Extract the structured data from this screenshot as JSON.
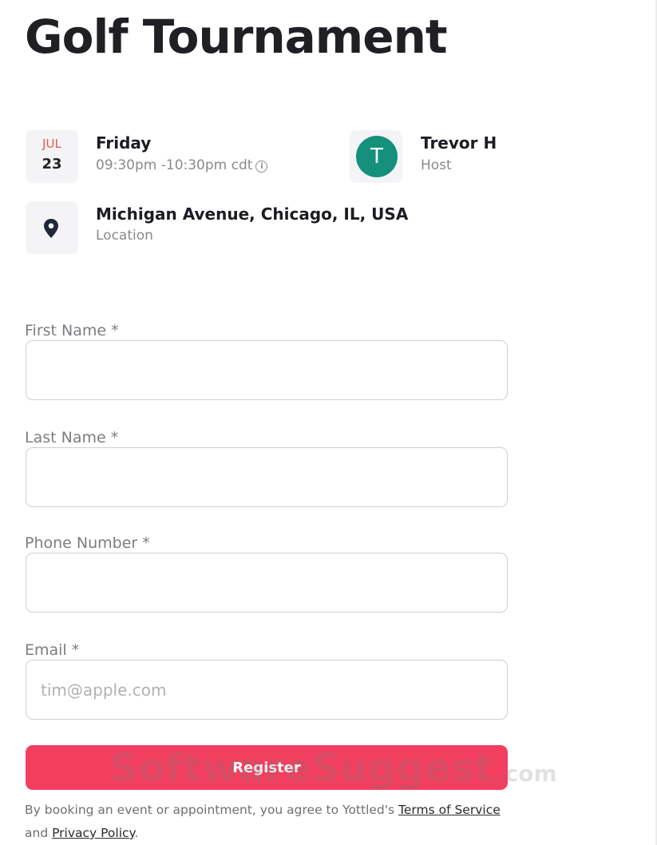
{
  "event": {
    "title": "Golf Tournament",
    "date": {
      "month": "JUL",
      "day": "23"
    },
    "weekday": "Friday",
    "time": "09:30pm -10:30pm cdt",
    "host": {
      "initial": "T",
      "name": "Trevor H",
      "role": "Host"
    },
    "location": {
      "name": "Michigan Avenue, Chicago, IL, USA",
      "label": "Location"
    }
  },
  "form": {
    "first_name": {
      "label": "First Name *",
      "value": ""
    },
    "last_name": {
      "label": "Last Name *",
      "value": ""
    },
    "phone": {
      "label": "Phone Number *",
      "value": ""
    },
    "email": {
      "label": "Email *",
      "value": "",
      "placeholder": "tim@apple.com"
    },
    "register_label": "Register"
  },
  "legal": {
    "prefix": "By booking an event or appointment, you agree to Yottled's ",
    "terms": "Terms of Service",
    "and": " and ",
    "privacy": "Privacy Policy",
    "suffix": "."
  },
  "watermark": {
    "text": "SoftwareSuggest",
    "suffix": ".com"
  },
  "colors": {
    "accent": "#f23f5f",
    "avatar": "#15907c",
    "month": "#e0584b"
  },
  "icons": {
    "location": "map-pin-icon",
    "time_info": "info-icon"
  }
}
